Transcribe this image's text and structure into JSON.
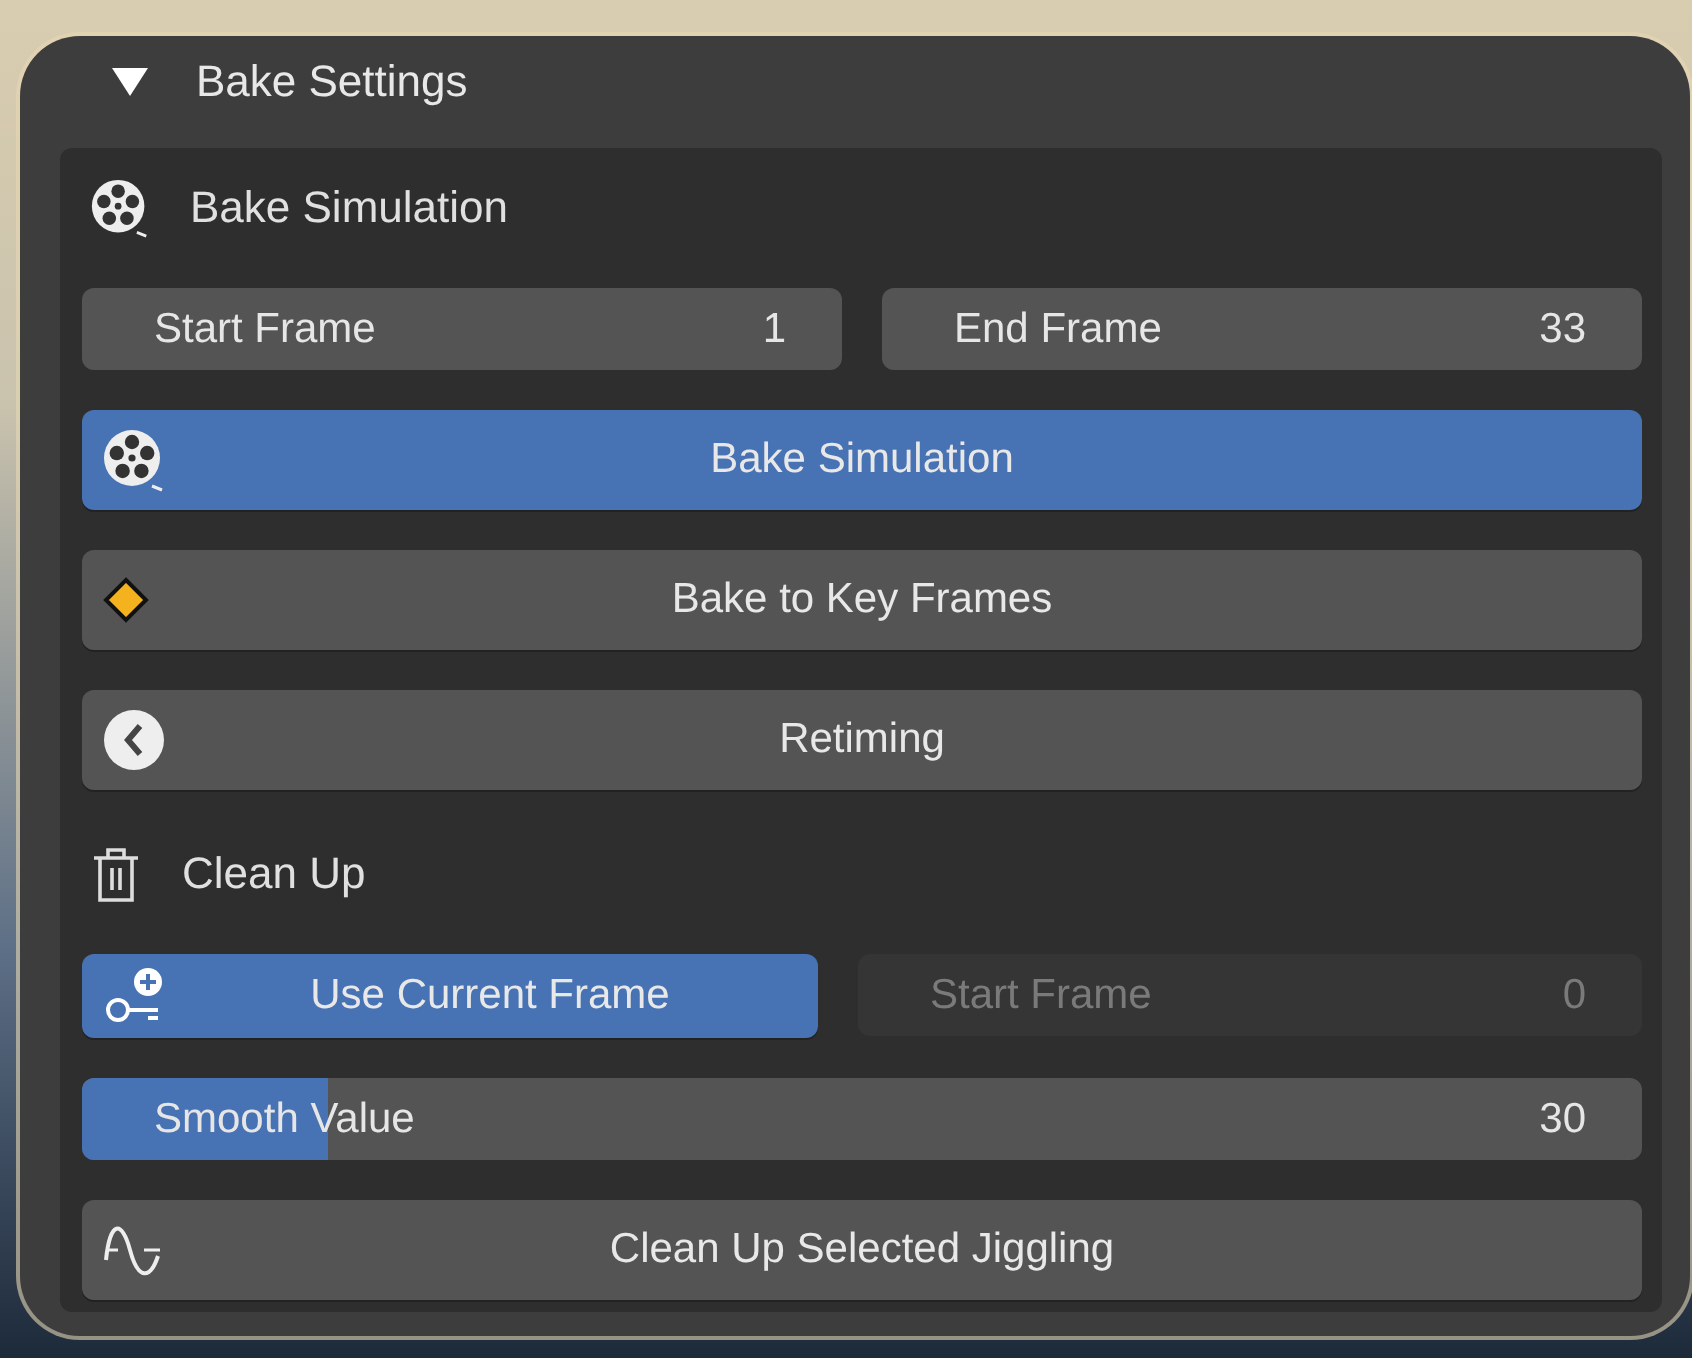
{
  "panel": {
    "title": "Bake Settings",
    "expanded": true
  },
  "bake": {
    "title": "Bake Simulation",
    "start_frame": {
      "label": "Start Frame",
      "value": "1"
    },
    "end_frame": {
      "label": "End Frame",
      "value": "33"
    },
    "bake_button": {
      "label": "Bake Simulation",
      "on": true
    },
    "key_frames_button": {
      "label": "Bake to Key Frames"
    },
    "retiming_button": {
      "label": "Retiming"
    }
  },
  "cleanup": {
    "title": "Clean Up",
    "use_current_frame": {
      "label": "Use Current Frame",
      "on": true
    },
    "start_frame": {
      "label": "Start Frame",
      "value": "0",
      "disabled": true
    },
    "smooth": {
      "label": "Smooth Value",
      "value": "30",
      "level": 0.158
    },
    "cleanup_button": {
      "label": "Clean Up Selected Jiggling"
    }
  }
}
